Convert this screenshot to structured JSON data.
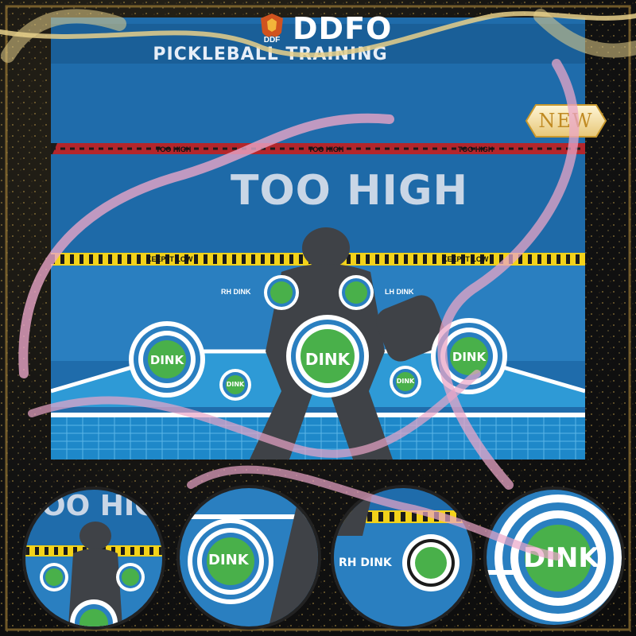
{
  "brand": {
    "name": "DDFO",
    "logo_text": "DDF"
  },
  "badge": {
    "label": "NEW"
  },
  "poster": {
    "title": "PICKLEBALL TRAINING",
    "too_high_big": "TOO HIGH",
    "tape_red_label": "TOO HIGH",
    "tape_yellow_label": "KEEP IT LOW",
    "rh_dink": "RH DINK",
    "lh_dink": "LH DINK",
    "dink": "DINK"
  },
  "insets": {
    "inset1_text": "OO HIG",
    "inset2_text": "DINK",
    "inset3_text": "RH DINK",
    "inset4_text": "DINK"
  },
  "colors": {
    "poster_blue": "#1f6cab",
    "court_blue": "#2e9ad6",
    "green": "#49b04a",
    "silhouette": "#3f4247",
    "tape_yellow": "#f2d21a",
    "tape_red": "#b3262c",
    "ribbon": "#e9a5c7",
    "gold": "#d9b04a"
  }
}
